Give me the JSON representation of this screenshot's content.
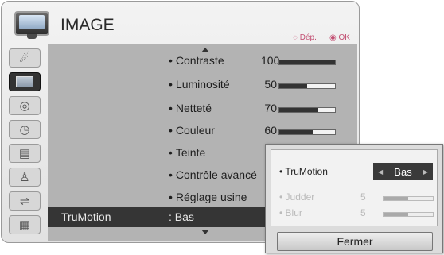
{
  "header": {
    "title": "IMAGE",
    "hint_move": "◌ Dép.",
    "hint_ok": "◉ OK"
  },
  "sidebar": {
    "items": [
      {
        "name": "satellite-dish-icon",
        "glyph": "☄"
      },
      {
        "name": "tv-icon",
        "glyph": ""
      },
      {
        "name": "speaker-icon",
        "glyph": "◎"
      },
      {
        "name": "clock-icon",
        "glyph": "◷"
      },
      {
        "name": "briefcase-icon",
        "glyph": "▤"
      },
      {
        "name": "lock-icon",
        "glyph": "🔒"
      },
      {
        "name": "usb-connector-icon",
        "glyph": "⌁"
      },
      {
        "name": "photo-icon",
        "glyph": "▦"
      }
    ]
  },
  "menu": {
    "contraste": {
      "label": "Contraste",
      "value": "100",
      "level": 1.0
    },
    "luminosite": {
      "label": "Luminosité",
      "value": "50",
      "level": 0.5
    },
    "nettete": {
      "label": "Netteté",
      "value": "70",
      "level": 0.7
    },
    "couleur": {
      "label": "Couleur",
      "value": "60",
      "level": 0.6
    },
    "teinte": {
      "label": "Teinte"
    },
    "controle": {
      "label": "Contrôle avancé"
    },
    "reglage": {
      "label": "Réglage usine"
    }
  },
  "status": {
    "label": "TruMotion",
    "value": ": Bas"
  },
  "popup": {
    "trumotion_label": "TruMotion",
    "trumotion_value": "Bas",
    "judder_label": "Judder",
    "judder_value": "5",
    "judder_level": 0.5,
    "blur_label": "Blur",
    "blur_value": "5",
    "blur_level": 0.5,
    "close_label": "Fermer"
  },
  "bullet": "•"
}
